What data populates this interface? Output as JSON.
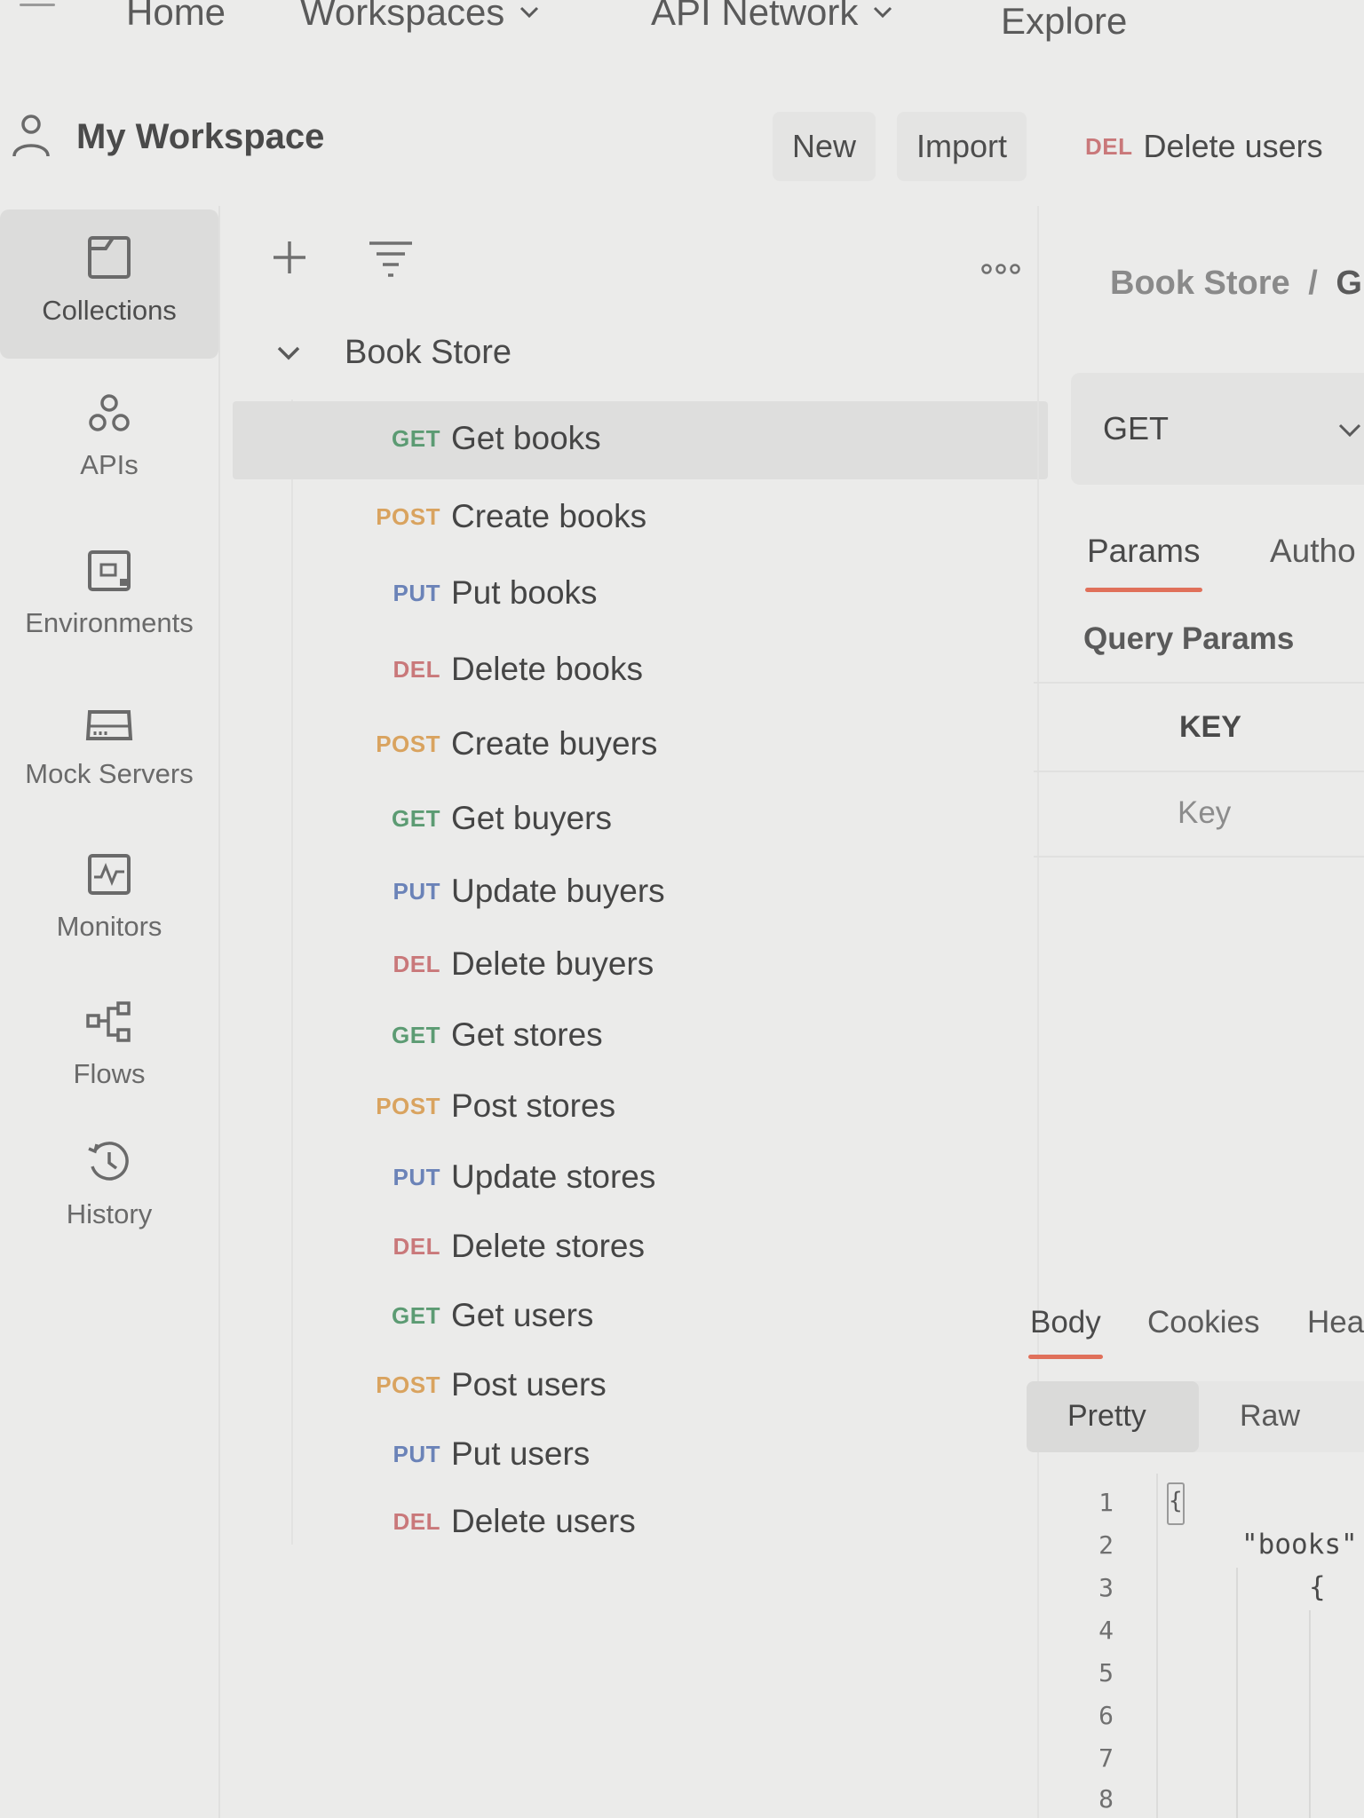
{
  "topnav": {
    "home": "Home",
    "workspaces": "Workspaces",
    "api_network": "API Network",
    "explore": "Explore"
  },
  "workspace": {
    "title": "My Workspace",
    "new_label": "New",
    "import_label": "Import"
  },
  "open_tab": {
    "method": "DEL",
    "name": "Delete users"
  },
  "sidebar": {
    "items": [
      {
        "label": "Collections",
        "icon": "collections-icon"
      },
      {
        "label": "APIs",
        "icon": "apis-icon"
      },
      {
        "label": "Environments",
        "icon": "environments-icon"
      },
      {
        "label": "Mock Servers",
        "icon": "mock-servers-icon"
      },
      {
        "label": "Monitors",
        "icon": "monitors-icon"
      },
      {
        "label": "Flows",
        "icon": "flows-icon"
      },
      {
        "label": "History",
        "icon": "history-icon"
      }
    ]
  },
  "collection": {
    "name": "Book Store",
    "requests": [
      {
        "method": "GET",
        "name": "Get books"
      },
      {
        "method": "POST",
        "name": "Create books"
      },
      {
        "method": "PUT",
        "name": "Put books"
      },
      {
        "method": "DEL",
        "name": "Delete books"
      },
      {
        "method": "POST",
        "name": "Create buyers"
      },
      {
        "method": "GET",
        "name": "Get buyers"
      },
      {
        "method": "PUT",
        "name": "Update buyers"
      },
      {
        "method": "DEL",
        "name": "Delete buyers"
      },
      {
        "method": "GET",
        "name": "Get stores"
      },
      {
        "method": "POST",
        "name": "Post stores"
      },
      {
        "method": "PUT",
        "name": "Update stores"
      },
      {
        "method": "DEL",
        "name": "Delete stores"
      },
      {
        "method": "GET",
        "name": "Get users"
      },
      {
        "method": "POST",
        "name": "Post users"
      },
      {
        "method": "PUT",
        "name": "Put users"
      },
      {
        "method": "DEL",
        "name": "Delete users"
      }
    ]
  },
  "request": {
    "breadcrumb_collection": "Book Store",
    "breadcrumb_sep": "/",
    "breadcrumb_request": "G",
    "method": "GET",
    "tabs": {
      "params": "Params",
      "auth": "Autho"
    },
    "query_params_title": "Query Params",
    "key_header": "KEY",
    "key_placeholder": "Key"
  },
  "response": {
    "tabs": {
      "body": "Body",
      "cookies": "Cookies",
      "headers": "Hea"
    },
    "views": {
      "pretty": "Pretty",
      "raw": "Raw"
    },
    "line_numbers": [
      "1",
      "2",
      "3",
      "4",
      "5",
      "6",
      "7",
      "8"
    ],
    "code": {
      "line1": "{",
      "line2": "\"books\"",
      "line3": "{"
    }
  },
  "colors": {
    "get": "#5c9b73",
    "post": "#d9a35f",
    "put": "#6b83b8",
    "del": "#c9787a",
    "accent": "#e0705a"
  }
}
